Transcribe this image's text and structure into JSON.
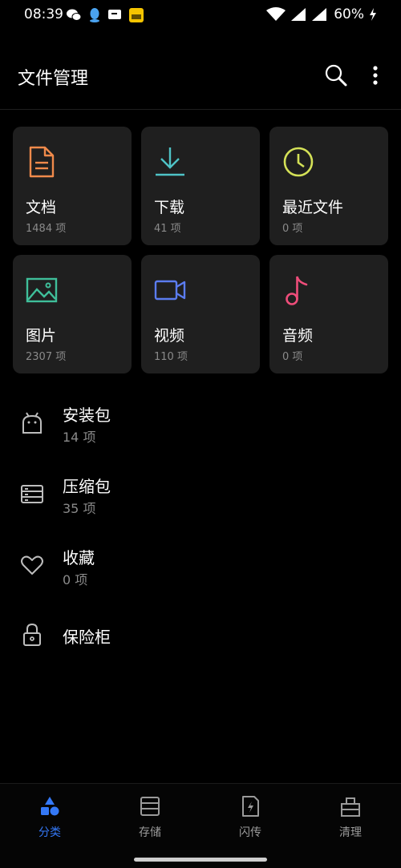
{
  "status_bar": {
    "time": "08:39",
    "battery": "60%"
  },
  "app_bar": {
    "title": "文件管理",
    "search_icon": "search-icon",
    "more_icon": "more-vertical-icon"
  },
  "categories": [
    {
      "label": "文档",
      "count": "1484 项",
      "icon": "document-icon",
      "color": "#f08a4b"
    },
    {
      "label": "下载",
      "count": "41 项",
      "icon": "download-icon",
      "color": "#4fc3c6"
    },
    {
      "label": "最近文件",
      "count": "0 项",
      "icon": "clock-icon",
      "color": "#d4e157"
    },
    {
      "label": "图片",
      "count": "2307 项",
      "icon": "image-icon",
      "color": "#3fbf9a"
    },
    {
      "label": "视频",
      "count": "110 项",
      "icon": "video-icon",
      "color": "#5b7cf0"
    },
    {
      "label": "音频",
      "count": "0 项",
      "icon": "music-note-icon",
      "color": "#ee4d7a"
    }
  ],
  "special": [
    {
      "label": "安装包",
      "count": "14 项",
      "icon": "android-icon"
    },
    {
      "label": "压缩包",
      "count": "35 项",
      "icon": "archive-icon"
    },
    {
      "label": "收藏",
      "count": "0 项",
      "icon": "heart-icon"
    },
    {
      "label": "保险柜",
      "icon": "lock-icon"
    }
  ],
  "bottom_nav": [
    {
      "label": "分类",
      "icon": "category-icon",
      "active": true
    },
    {
      "label": "存储",
      "icon": "storage-icon",
      "active": false
    },
    {
      "label": "闪传",
      "icon": "flash-transfer-icon",
      "active": false
    },
    {
      "label": "清理",
      "icon": "clean-icon",
      "active": false
    }
  ],
  "colors": {
    "accent": "#3478f6",
    "tile_bg": "#1f1f1f",
    "secondary_text": "#8a8a8a"
  }
}
